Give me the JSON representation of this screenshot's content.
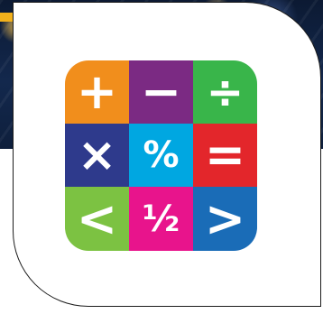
{
  "icon": {
    "cells": [
      {
        "symbol": "+",
        "color": "#f18e1c"
      },
      {
        "symbol": "−",
        "color": "#7b2a83"
      },
      {
        "symbol": "÷",
        "color": "#39b54a"
      },
      {
        "symbol": "×",
        "color": "#2e3a8c"
      },
      {
        "symbol": "%",
        "color": "#00a7e1"
      },
      {
        "symbol": "=",
        "color": "#e3262b"
      },
      {
        "symbol": "<",
        "color": "#7cc242"
      },
      {
        "symbol": "½",
        "color": "#e8148c"
      },
      {
        "symbol": ">",
        "color": "#1a6cb7"
      }
    ]
  },
  "colors": {
    "banner": "#13284d",
    "accent": "#f2b11c",
    "card": "#ffffff"
  }
}
